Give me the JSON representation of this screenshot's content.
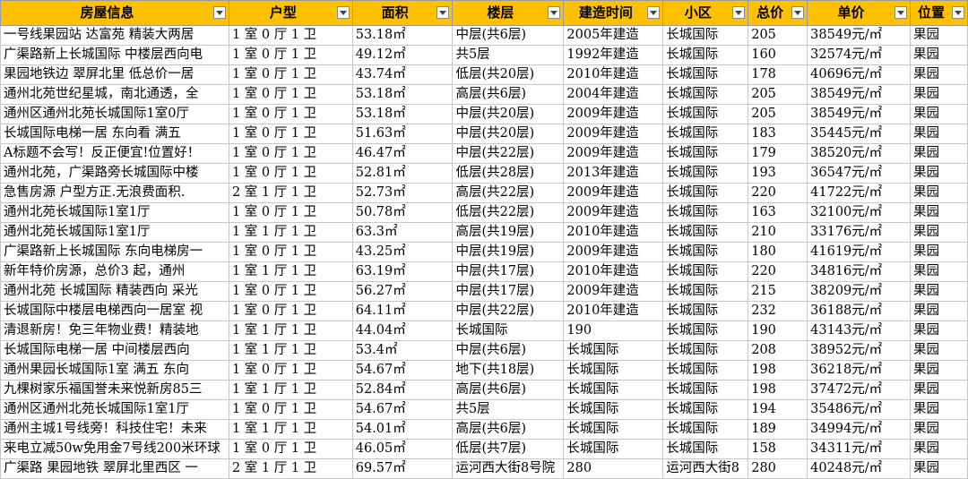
{
  "headers": [
    "房屋信息",
    "户型",
    "面积",
    "楼层",
    "建造时间",
    "小区",
    "总价",
    "单价",
    "位置"
  ],
  "rows": [
    [
      "一号线果园站 达富苑 精装大两居",
      "1 室 0 厅 1 卫",
      "53.18㎡",
      "中层(共6层)",
      "2005年建造",
      "长城国际",
      "205",
      "38549元/㎡",
      "果园"
    ],
    [
      "广渠路新上长城国际 中楼层西向电",
      "1 室 0 厅 1 卫",
      "49.12㎡",
      "共5层",
      "1992年建造",
      "长城国际",
      "160",
      "32574元/㎡",
      "果园"
    ],
    [
      "果园地铁边 翠屏北里 低总价一居",
      "1 室 0 厅 1 卫",
      "43.74㎡",
      "低层(共20层)",
      "2010年建造",
      "长城国际",
      "178",
      "40696元/㎡",
      "果园"
    ],
    [
      "通州北苑世纪星城，南北通透，全",
      "1 室 0 厅 1 卫",
      "53.18㎡",
      "高层(共6层)",
      "2004年建造",
      "长城国际",
      "205",
      "38549元/㎡",
      "果园"
    ],
    [
      "通州区通州北苑长城国际1室0厅",
      "1 室 0 厅 1 卫",
      "53.18㎡",
      "中层(共20层)",
      "2009年建造",
      "长城国际",
      "205",
      "38549元/㎡",
      "果园"
    ],
    [
      "长城国际电梯一居 东向看  满五",
      "1 室 0 厅 1 卫",
      "51.63㎡",
      "中层(共20层)",
      "2009年建造",
      "长城国际",
      "183",
      "35445元/㎡",
      "果园"
    ],
    [
      "A标题不会写！反正便宜!位置好！",
      "1 室 0 厅 1 卫",
      "46.47㎡",
      "中层(共22层)",
      "2009年建造",
      "长城国际",
      "179",
      "38520元/㎡",
      "果园"
    ],
    [
      "通州北苑，广渠路旁长城国际中楼",
      "1 室 0 厅 1 卫",
      "52.81㎡",
      "低层(共28层)",
      "2013年建造",
      "长城国际",
      "193",
      "36547元/㎡",
      "果园"
    ],
    [
      "急售房源  户型方正.无浪费面积.",
      "2 室 1 厅 1 卫",
      "52.73㎡",
      "高层(共22层)",
      "2009年建造",
      "长城国际",
      "220",
      "41722元/㎡",
      "果园"
    ],
    [
      "通州北苑长城国际1室1厅",
      "1 室 0 厅 1 卫",
      "50.78㎡",
      "低层(共22层)",
      "2009年建造",
      "长城国际",
      "163",
      "32100元/㎡",
      "果园"
    ],
    [
      "通州北苑长城国际1室1厅",
      "1 室 1 厅 1 卫",
      "63.3㎡",
      "高层(共19层)",
      "2010年建造",
      "长城国际",
      "210",
      "33176元/㎡",
      "果园"
    ],
    [
      "广渠路新上长城国际 东向电梯房一",
      "1 室 0 厅 1 卫",
      "43.25㎡",
      "中层(共19层)",
      "2009年建造",
      "长城国际",
      "180",
      "41619元/㎡",
      "果园"
    ],
    [
      "新年特价房源，总价3   起，通州",
      "1 室 1 厅 1 卫",
      "63.19㎡",
      "中层(共17层)",
      "2010年建造",
      "长城国际",
      "220",
      "34816元/㎡",
      "果园"
    ],
    [
      "通州北苑 长城国际 精装西向 采光",
      "1 室 0 厅 1 卫",
      "56.27㎡",
      "中层(共17层)",
      "2009年建造",
      "长城国际",
      "215",
      "38209元/㎡",
      "果园"
    ],
    [
      "长城国际中楼层电梯西向一居室 视",
      "1 室 0 厅 1 卫",
      "64.11㎡",
      "中层(共22层)",
      "2010年建造",
      "长城国际",
      "232",
      "36188元/㎡",
      "果园"
    ],
    [
      "清退新房！免三年物业费！精装地",
      "1 室 1 厅 1 卫",
      "44.04㎡",
      "长城国际",
      "190",
      "长城国际",
      "190",
      "43143元/㎡",
      "果园"
    ],
    [
      "长城国际电梯一居 中间楼层西向",
      "1 室 1 厅 1 卫",
      "53.4㎡",
      "中层(共6层)",
      "长城国际",
      "长城国际",
      "208",
      "38952元/㎡",
      "果园"
    ],
    [
      "通州果园长城国际1室 满五  东向",
      "1 室 0 厅 1 卫",
      "54.67㎡",
      "地下(共18层)",
      "长城国际",
      "长城国际",
      "198",
      "36218元/㎡",
      "果园"
    ],
    [
      "九棵树家乐福国誉未来悦新房85三",
      "1 室 1 厅 1 卫",
      "52.84㎡",
      "高层(共6层)",
      "长城国际",
      "长城国际",
      "198",
      "37472元/㎡",
      "果园"
    ],
    [
      "通州区通州北苑长城国际1室1厅",
      "1 室 0 厅 1 卫",
      "54.67㎡",
      "共5层",
      "长城国际",
      "长城国际",
      "194",
      "35486元/㎡",
      "果园"
    ],
    [
      "通州主城1号线旁！科技住宅！未来",
      "1 室 1 厅 1 卫",
      "54.01㎡",
      "高层(共6层)",
      "长城国际",
      "长城国际",
      "189",
      "34994元/㎡",
      "果园"
    ],
    [
      "来电立减50w免用金7号线200米环球",
      "1 室 0 厅 1 卫",
      "46.05㎡",
      "低层(共7层)",
      "长城国际",
      "长城国际",
      "158",
      "34311元/㎡",
      "果园"
    ],
    [
      "广渠路 果园地铁 翠屏北里西区 一",
      "2 室 1 厅 1 卫",
      "69.57㎡",
      "运河西大街8号院",
      "280",
      "运河西大街8",
      "280",
      "40248元/㎡",
      "果园"
    ]
  ]
}
